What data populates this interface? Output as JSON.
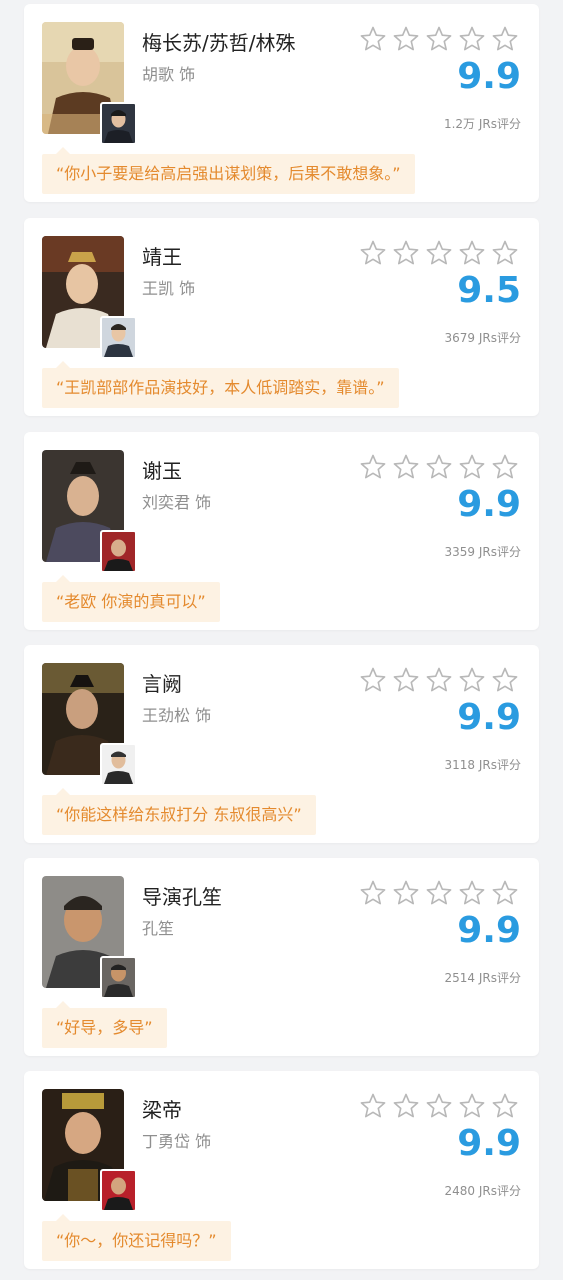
{
  "colors": {
    "score": "#2a9be0",
    "quote_text": "#e48a2e",
    "quote_bg": "#fdf2e3",
    "star_outline": "#b8b8b8"
  },
  "star_icon": "star-outline-icon",
  "star_max": 5,
  "items": [
    {
      "role": "梅长苏/苏哲/林殊",
      "actor": "胡歌 饰",
      "score": "9.9",
      "count": "1.2万 JRs评分",
      "quote": "“你小子要是给高启强出谋划策，后果不敢想象。”",
      "stars_filled": 0
    },
    {
      "role": "靖王",
      "actor": "王凯 饰",
      "score": "9.5",
      "count": "3679 JRs评分",
      "quote": "“王凯部部作品演技好，本人低调踏实，靠谱。”",
      "stars_filled": 0
    },
    {
      "role": "谢玉",
      "actor": "刘奕君 饰",
      "score": "9.9",
      "count": "3359 JRs评分",
      "quote": "“老欧 你演的真可以”",
      "stars_filled": 0
    },
    {
      "role": "言阙",
      "actor": "王劲松 饰",
      "score": "9.9",
      "count": "3118 JRs评分",
      "quote": "“你能这样给东叔打分 东叔很高兴”",
      "stars_filled": 0
    },
    {
      "role": "导演孔笙",
      "actor": "孔笙",
      "score": "9.9",
      "count": "2514 JRs评分",
      "quote": "“好导，多导”",
      "stars_filled": 0
    },
    {
      "role": "梁帝",
      "actor": "丁勇岱 饰",
      "score": "9.9",
      "count": "2480 JRs评分",
      "quote": "“你～，你还记得吗？”",
      "stars_filled": 0
    }
  ]
}
